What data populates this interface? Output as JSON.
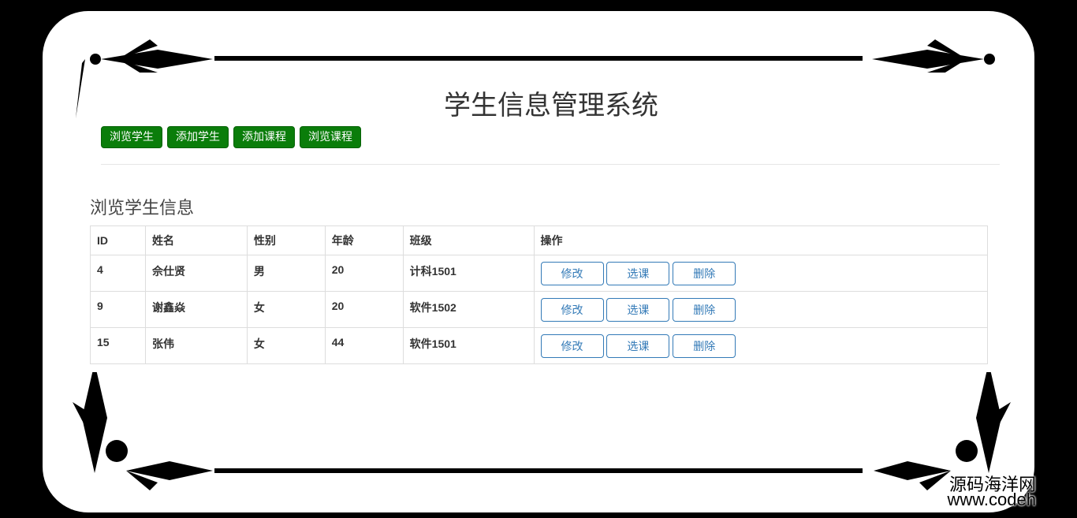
{
  "header": {
    "title": "学生信息管理系统"
  },
  "nav": [
    {
      "label": "浏览学生"
    },
    {
      "label": "添加学生"
    },
    {
      "label": "添加课程"
    },
    {
      "label": "浏览课程"
    }
  ],
  "section": {
    "title": "浏览学生信息"
  },
  "table": {
    "headers": [
      "ID",
      "姓名",
      "性别",
      "年龄",
      "班级",
      "操作"
    ],
    "rows": [
      {
        "id": "4",
        "name": "佘仕贤",
        "gender": "男",
        "age": "20",
        "class": "计科1501"
      },
      {
        "id": "9",
        "name": "谢鑫焱",
        "gender": "女",
        "age": "20",
        "class": "软件1502"
      },
      {
        "id": "15",
        "name": "张伟",
        "gender": "女",
        "age": "44",
        "class": "软件1501"
      }
    ],
    "actions": {
      "edit": "修改",
      "select_course": "选课",
      "delete": "删除"
    }
  },
  "watermark": {
    "line1": "源码海洋网",
    "line2": "www.codeh"
  },
  "colors": {
    "nav_button": "#0a7d0a",
    "action_button": "#337ab7"
  }
}
